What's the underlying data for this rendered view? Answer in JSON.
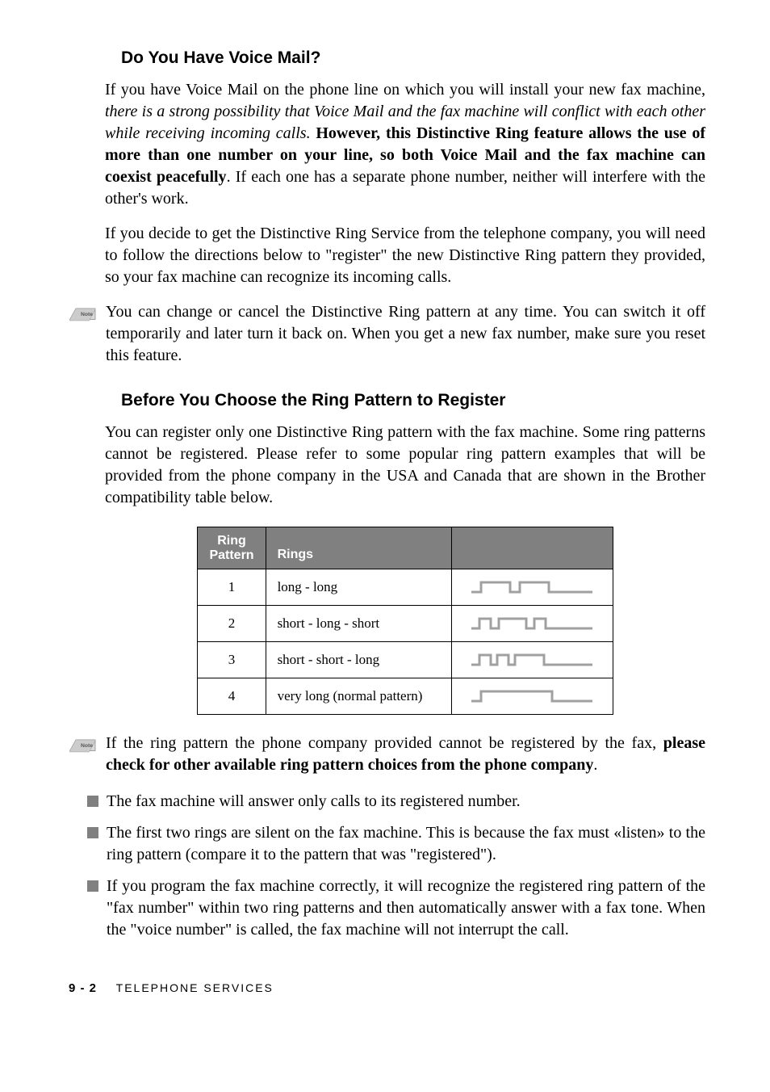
{
  "section1": {
    "heading": "Do You Have Voice Mail?",
    "para1_part1": "If you have Voice Mail on the phone line on which you will install your new fax machine, ",
    "para1_italic": "there is a strong possibility that Voice Mail and the fax machine will conflict with each other while receiving incoming calls.",
    "para1_bold": " However, this Distinctive Ring feature allows the use of more than one number on your line, so both Voice Mail and the fax machine can coexist peacefully",
    "para1_part2": ". If each one has a separate phone number, neither will interfere with the other's work.",
    "para2": "If you decide to get the Distinctive Ring Service from the telephone company, you will need to follow the directions below to \"register\" the new Distinctive Ring pattern they provided, so your fax machine can recognize its incoming calls.",
    "note1": "You can change or cancel the Distinctive Ring pattern at any time. You can switch it off temporarily and later turn it back on. When you get a new fax number, make sure you reset this feature."
  },
  "section2": {
    "heading": "Before You Choose the Ring Pattern to Register",
    "para1": "You can register only one Distinctive Ring pattern with the fax machine. Some ring patterns cannot be registered. Please refer to some popular ring pattern examples that will be provided from the phone company in the USA and Canada that are shown in the Brother compatibility table below."
  },
  "table": {
    "headers": {
      "col1_line1": "Ring",
      "col1_line2": "Pattern",
      "col2": "Rings"
    },
    "rows": [
      {
        "num": "1",
        "desc": "long - long"
      },
      {
        "num": "2",
        "desc": "short - long - short"
      },
      {
        "num": "3",
        "desc": "short - short - long"
      },
      {
        "num": "4",
        "desc": "very long (normal pattern)"
      }
    ]
  },
  "note2": {
    "part1": "If the ring pattern the phone company provided cannot be registered by the fax, ",
    "bold": "please check for other available ring pattern choices from the phone company",
    "part2": "."
  },
  "bullets": [
    "The fax machine will answer only calls to its registered number.",
    "The first two rings are silent on the fax machine. This is because the fax must «listen» to the ring pattern (compare it to the pattern that was \"registered\").",
    "If you program the fax machine correctly, it will recognize the registered ring pattern of the \"fax number\" within two ring patterns and then automatically answer with a fax tone. When the \"voice number\" is called, the fax machine will not interrupt the call."
  ],
  "footer": {
    "page": "9 - 2",
    "section": "TELEPHONE SERVICES"
  }
}
